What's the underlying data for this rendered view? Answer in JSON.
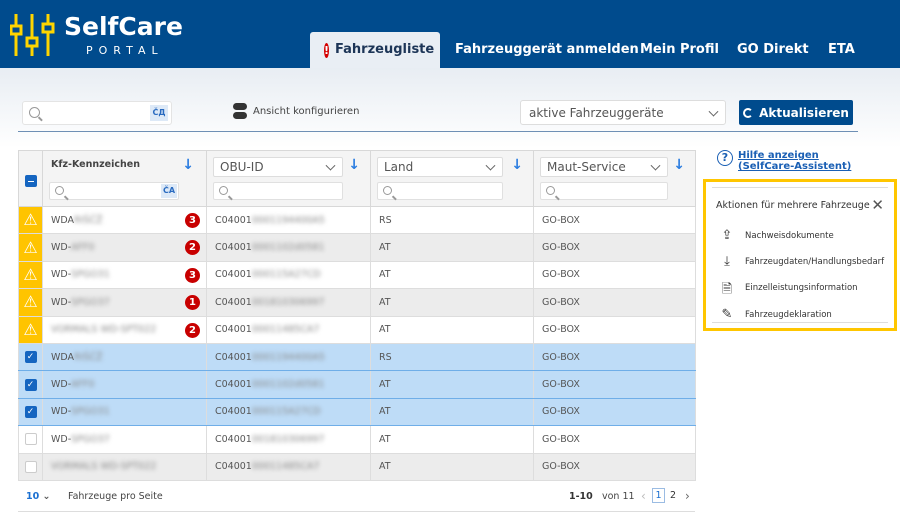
{
  "header": {
    "brand": "SelfCare",
    "brand_sub": "PORTAL",
    "tabs": [
      {
        "label": "Fahrzeugliste",
        "alert": "!"
      },
      {
        "label": "Fahrzeuggerät anmelden"
      },
      {
        "label": "Mein Profil"
      },
      {
        "label": "GO Direkt"
      },
      {
        "label": "ETA"
      }
    ]
  },
  "toolbar": {
    "search_placeholder": "",
    "cyrillic": "ČД",
    "configure": "Ansicht konfigurieren",
    "filter_value": "aktive Fahrzeuggeräte",
    "refresh": "Aktualisieren"
  },
  "table": {
    "columns": [
      {
        "label": "Kfz-Kennzeichen"
      },
      {
        "label": "OBU-ID"
      },
      {
        "label": "Land"
      },
      {
        "label": "Maut-Service"
      }
    ],
    "cyrillic": "ČA",
    "rows": [
      {
        "warn": true,
        "checked": false,
        "plate_prefix": "WDA",
        "plate_blur": "RIŠČŽ",
        "badge": "3",
        "obu_prefix": "C04001",
        "obu_blur": "0001194400A5",
        "land": "RS",
        "service": "GO-BOX"
      },
      {
        "warn": true,
        "checked": false,
        "plate_prefix": "WD-",
        "plate_blur": "AFF0",
        "badge": "2",
        "obu_prefix": "C04001",
        "obu_blur": "0001102d0581",
        "land": "AT",
        "service": "GO-BOX"
      },
      {
        "warn": true,
        "checked": false,
        "plate_prefix": "WD-",
        "plate_blur": "SPGO31",
        "badge": "3",
        "obu_prefix": "C04001",
        "obu_blur": "000115A27CD",
        "land": "AT",
        "service": "GO-BOX"
      },
      {
        "warn": true,
        "checked": false,
        "plate_prefix": "WD-",
        "plate_blur": "SPGO37",
        "badge": "1",
        "obu_prefix": "C04001",
        "obu_blur": "001810306997",
        "land": "AT",
        "service": "GO-BOX"
      },
      {
        "warn": true,
        "checked": false,
        "plate_prefix": "",
        "plate_blur": "VORMALS WD-SPT022",
        "badge": "2",
        "obu_prefix": "C04001",
        "obu_blur": "00011485CA7",
        "land": "AT",
        "service": "GO-BOX"
      },
      {
        "warn": false,
        "checked": true,
        "plate_prefix": "WDA",
        "plate_blur": "RIŠČŽ",
        "badge": "",
        "obu_prefix": "C04001",
        "obu_blur": "0001194400A5",
        "land": "RS",
        "service": "GO-BOX"
      },
      {
        "warn": false,
        "checked": true,
        "plate_prefix": "WD-",
        "plate_blur": "AFF0",
        "badge": "",
        "obu_prefix": "C04001",
        "obu_blur": "0001102d0581",
        "land": "AT",
        "service": "GO-BOX"
      },
      {
        "warn": false,
        "checked": true,
        "plate_prefix": "WD-",
        "plate_blur": "SPGO31",
        "badge": "",
        "obu_prefix": "C04001",
        "obu_blur": "000115A27CD",
        "land": "AT",
        "service": "GO-BOX"
      },
      {
        "warn": false,
        "checked": false,
        "plate_prefix": "WD-",
        "plate_blur": "SPGO37",
        "badge": "",
        "obu_prefix": "C04001",
        "obu_blur": "001810306997",
        "land": "AT",
        "service": "GO-BOX"
      },
      {
        "warn": false,
        "checked": false,
        "plate_prefix": "",
        "plate_blur": "VORMALS WD-SPT022",
        "badge": "",
        "obu_prefix": "C04001",
        "obu_blur": "00011485CA7",
        "land": "AT",
        "service": "GO-BOX"
      }
    ]
  },
  "help": {
    "label": "Hilfe anzeigen (SelfCare-Assistent)"
  },
  "actions": {
    "title": "Aktionen für mehrere Fahrzeuge",
    "items": [
      {
        "label": "Nachweisdokumente",
        "icon": "upload-icon"
      },
      {
        "label": "Fahrzeugdaten/Handlungsbedarf",
        "icon": "download-icon"
      },
      {
        "label": "Einzelleistungsinformation",
        "icon": "document-info-icon"
      },
      {
        "label": "Fahrzeugdeklaration",
        "icon": "document-edit-icon"
      }
    ]
  },
  "pagination": {
    "page_size": "10",
    "page_size_label": "Fahrzeuge pro Seite",
    "range": "1-10",
    "of_label": "von 11",
    "pages": [
      "1",
      "2"
    ],
    "current": "1"
  }
}
